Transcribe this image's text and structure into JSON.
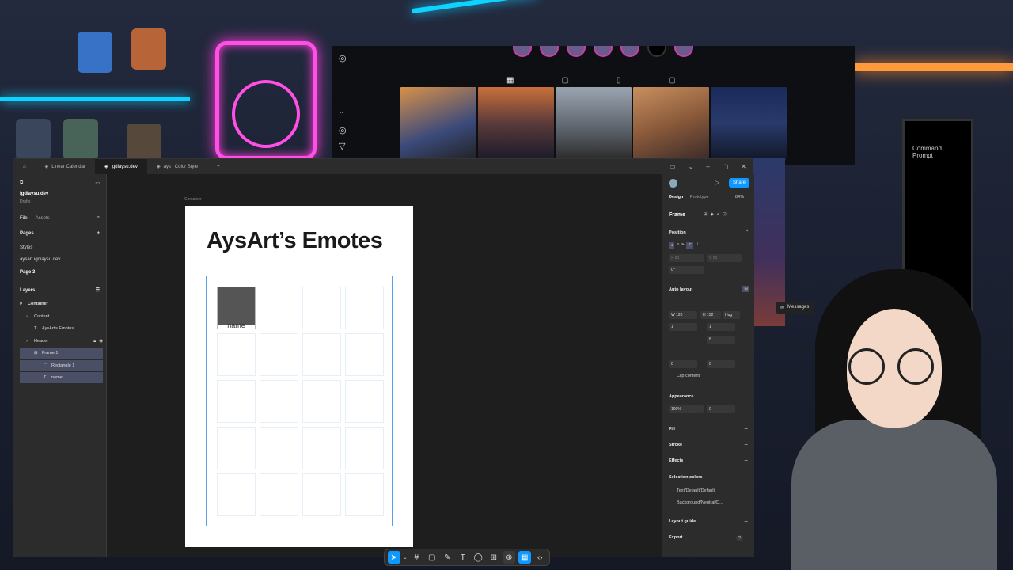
{
  "figma": {
    "tabs": [
      {
        "label": "Linear Calendar"
      },
      {
        "label": "igdiaysu.dev"
      },
      {
        "label": "ays | Color Style"
      }
    ],
    "left_panel": {
      "project": "igdiaysu.dev",
      "subtitle": "Drafts",
      "file_tab": "File",
      "assets_tab": "Assets",
      "pages_heading": "Pages",
      "pages": [
        "Styles",
        "aysart.igdiaysu.dev",
        "Page 3"
      ],
      "layers_heading": "Layers",
      "layers": [
        {
          "label": "Container"
        },
        {
          "label": "Content"
        },
        {
          "label": "AysArt's Emotes"
        },
        {
          "label": "Header"
        },
        {
          "label": "Frame 1"
        },
        {
          "label": "Rectangle 1"
        },
        {
          "label": "name"
        }
      ]
    },
    "canvas": {
      "frame_label": "Container",
      "title": "AysArt’s Emotes",
      "first_cell_label": "name"
    },
    "right_panel": {
      "design_tab": "Design",
      "prototype_tab": "Prototype",
      "zoom": "84%",
      "share": "Share",
      "frame_label": "Frame",
      "position": "Position",
      "x_label": "X",
      "x_value": "83",
      "y_label": "Y",
      "y_value": "55",
      "rotation": "0°",
      "auto_layout": "Auto layout",
      "w_label": "W",
      "w_value": "120",
      "h_label": "H",
      "h_value": "152",
      "hug": "Hug",
      "gap_cols": "1",
      "gap_rows": "1",
      "spacing": "8",
      "pad_h": "0",
      "pad_v": "0",
      "clip_content": "Clip content",
      "appearance": "Appearance",
      "opacity": "100%",
      "radius": "0",
      "fill": "Fill",
      "stroke": "Stroke",
      "effects": "Effects",
      "selection_colors": "Selection colors",
      "color1": "Text/Default/Default",
      "color2": "Background/Neutral/D...",
      "layout_guide": "Layout guide",
      "export": "Export",
      "help": "?"
    }
  },
  "overlay": {
    "messages": "Messages",
    "terminal_text": "Command Prompt"
  },
  "colors": {
    "accent": "#0d99ff",
    "selection": "#5aa0e6",
    "neon_pink": "#ff4fe6",
    "neon_cyan": "#0fd3ff"
  }
}
